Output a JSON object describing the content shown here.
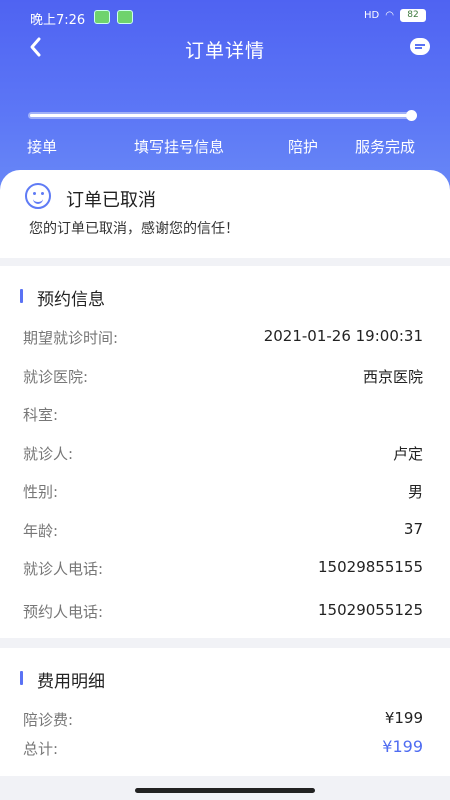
{
  "status_bar": {
    "time": "晚上7:26",
    "signal": "HD",
    "battery": "82"
  },
  "nav": {
    "back_icon": "chevron-left-icon",
    "title": "订单详情",
    "chat_icon": "message-icon"
  },
  "progress": {
    "percent": 100,
    "steps": [
      "接单",
      "填写挂号信息",
      "陪护",
      "服务完成"
    ]
  },
  "order_status": {
    "icon": "smile-icon",
    "title": "订单已取消",
    "message": "您的订单已取消，感谢您的信任！"
  },
  "appointment": {
    "title": "预约信息",
    "rows": [
      {
        "label": "期望就诊时间:",
        "value": "2021-01-26 19:00:31"
      },
      {
        "label": "就诊医院:",
        "value": "西京医院"
      },
      {
        "label": "科室:",
        "value": ""
      },
      {
        "label": "就诊人:",
        "value": "卢定"
      },
      {
        "label": "性别:",
        "value": "男"
      },
      {
        "label": "年龄:",
        "value": "37"
      },
      {
        "label": "就诊人电话:",
        "value": "15029855155"
      },
      {
        "label": "预约人电话:",
        "value": "15029055125"
      }
    ]
  },
  "fees": {
    "title": "费用明细",
    "rows": [
      {
        "label": "陪诊费:",
        "value": "¥199"
      },
      {
        "label": "总计:",
        "value": "¥199"
      }
    ]
  },
  "colors": {
    "accent": "#4f6cf1",
    "header_top": "#4f63f2",
    "header_bottom": "#6a8af7"
  }
}
